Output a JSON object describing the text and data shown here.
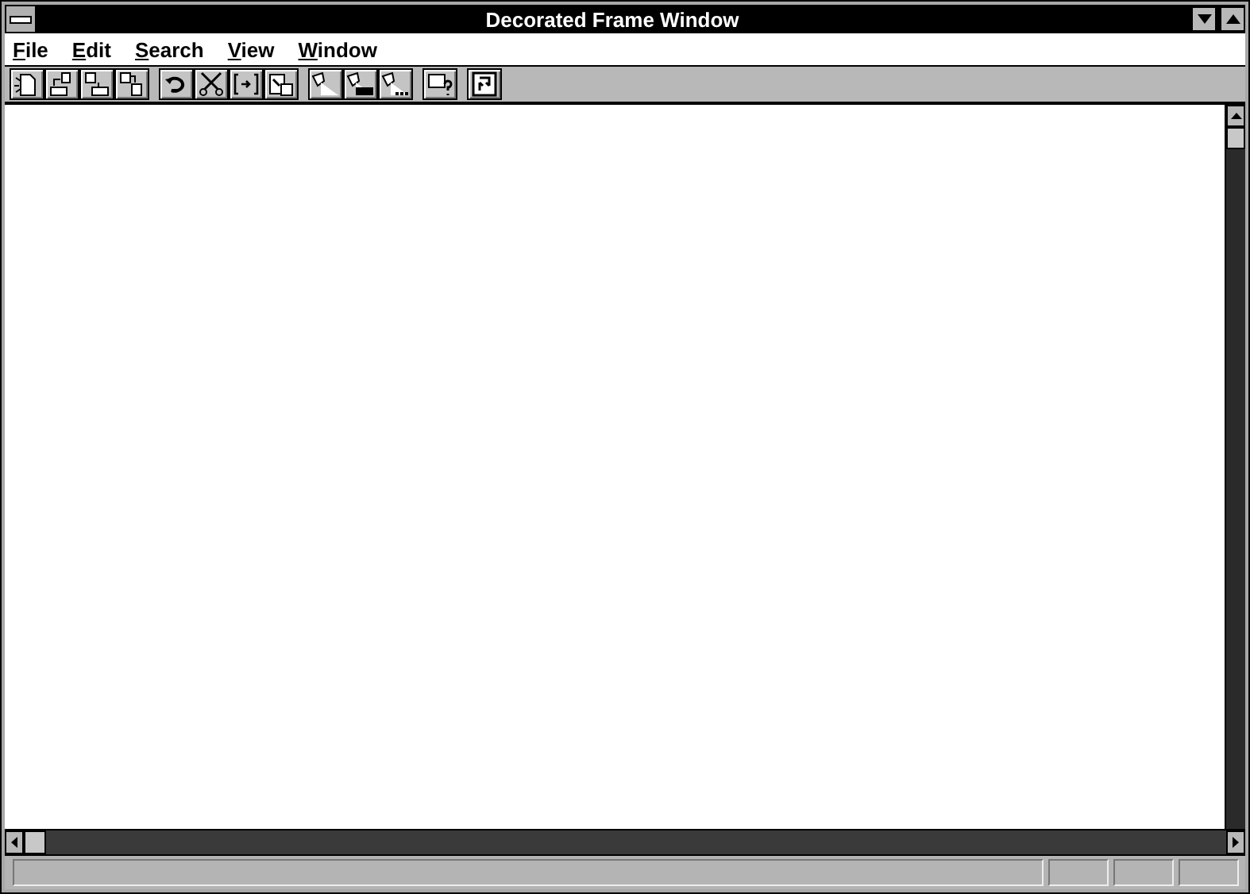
{
  "window": {
    "title": "Decorated Frame Window"
  },
  "menu": [
    {
      "label": "File"
    },
    {
      "label": "Edit"
    },
    {
      "label": "Search"
    },
    {
      "label": "View"
    },
    {
      "label": "Window"
    }
  ],
  "toolbar": [
    [
      {
        "kind": "new"
      },
      {
        "kind": "open"
      },
      {
        "kind": "save"
      },
      {
        "kind": "saveas"
      }
    ],
    [
      {
        "kind": "undo"
      },
      {
        "kind": "cut"
      },
      {
        "kind": "copy"
      },
      {
        "kind": "paste"
      }
    ],
    [
      {
        "kind": "find"
      },
      {
        "kind": "replace"
      },
      {
        "kind": "findnext"
      }
    ],
    [
      {
        "kind": "help"
      }
    ],
    [
      {
        "kind": "refresh"
      }
    ]
  ]
}
